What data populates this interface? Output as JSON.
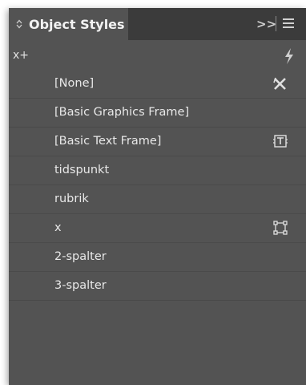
{
  "panel": {
    "title": "Object Styles",
    "collapse_label": ">>",
    "menu_icon": "hamburger-menu-icon"
  },
  "toolbar": {
    "left_label": "x+",
    "right_icon": "lightning-icon"
  },
  "styles": [
    {
      "label": "[None]",
      "icon": "no-style-icon"
    },
    {
      "label": "[Basic Graphics Frame]",
      "icon": ""
    },
    {
      "label": "[Basic Text Frame]",
      "icon": "text-frame-icon"
    },
    {
      "label": "tidspunkt",
      "icon": ""
    },
    {
      "label": "rubrik",
      "icon": ""
    },
    {
      "label": "x",
      "icon": "graphic-frame-icon"
    },
    {
      "label": "2-spalter",
      "icon": ""
    },
    {
      "label": "3-spalter",
      "icon": ""
    }
  ],
  "colors": {
    "panel_bg": "#535353",
    "tabbar_bg": "#3b3b3b",
    "text": "#e8e8e8"
  }
}
